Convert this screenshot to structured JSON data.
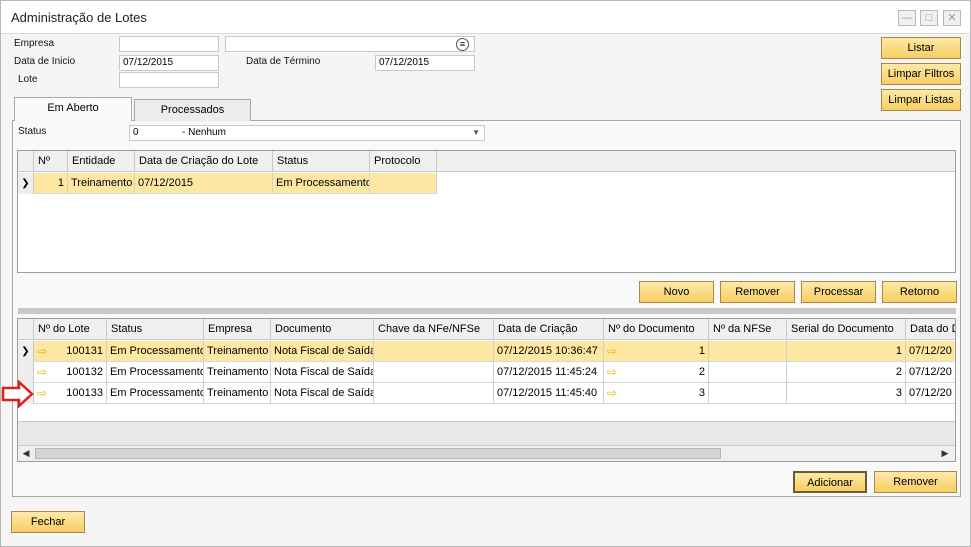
{
  "window": {
    "title": "Administração de Lotes"
  },
  "filters": {
    "empresa_label": "Empresa",
    "empresa_value": "",
    "data_inicio_label": "Data de Inicio",
    "data_inicio_value": "07/12/2015",
    "data_termino_label": "Data de Término",
    "data_termino_value": "07/12/2015",
    "lote_label": "Lote",
    "lote_value": ""
  },
  "side_buttons": {
    "listar": "Listar",
    "limpar_filtros": "Limpar Filtros",
    "limpar_listas": "Limpar Listas"
  },
  "tabs": [
    {
      "label": "Em Aberto"
    },
    {
      "label": "Processados"
    }
  ],
  "status": {
    "label": "Status",
    "value_code": "0",
    "value_text": "- Nenhum"
  },
  "top_grid": {
    "headers": [
      "Nº",
      "Entidade",
      "Data de Criação do Lote",
      "Status",
      "Protocolo"
    ],
    "rows": [
      [
        "1",
        "Treinamento",
        "07/12/2015",
        "Em Processamento",
        ""
      ]
    ]
  },
  "mid_buttons": {
    "novo": "Novo",
    "remover": "Remover",
    "processar": "Processar",
    "retorno": "Retorno"
  },
  "bottom_grid": {
    "headers": [
      "Nº do Lote",
      "Status",
      "Empresa",
      "Documento",
      "Chave da NFe/NFSe",
      "Data de Criação",
      "Nº do Documento",
      "Nº da NFSe",
      "Serial do Documento",
      "Data do D"
    ],
    "rows": [
      [
        "100131",
        "Em Processamento",
        "Treinamento",
        "Nota Fiscal de Saída",
        "",
        "07/12/2015 10:36:47",
        "1",
        "",
        "1",
        "07/12/20"
      ],
      [
        "100132",
        "Em Processamento",
        "Treinamento",
        "Nota Fiscal de Saída",
        "",
        "07/12/2015 11:45:24",
        "2",
        "",
        "2",
        "07/12/20"
      ],
      [
        "100133",
        "Em Processamento",
        "Treinamento",
        "Nota Fiscal de Saída",
        "",
        "07/12/2015 11:45:40",
        "3",
        "",
        "3",
        "07/12/20"
      ]
    ]
  },
  "bottom_buttons": {
    "adicionar": "Adicionar",
    "remover": "Remover"
  },
  "footer": {
    "fechar": "Fechar"
  },
  "icons": {
    "lookup": "list-icon",
    "row_link": "link-arrow-icon",
    "annotation": "red-pointer-arrow"
  },
  "colors": {
    "selected_row": "#fde7a2",
    "button": "#f7cf62",
    "annotation": "#e02020"
  }
}
